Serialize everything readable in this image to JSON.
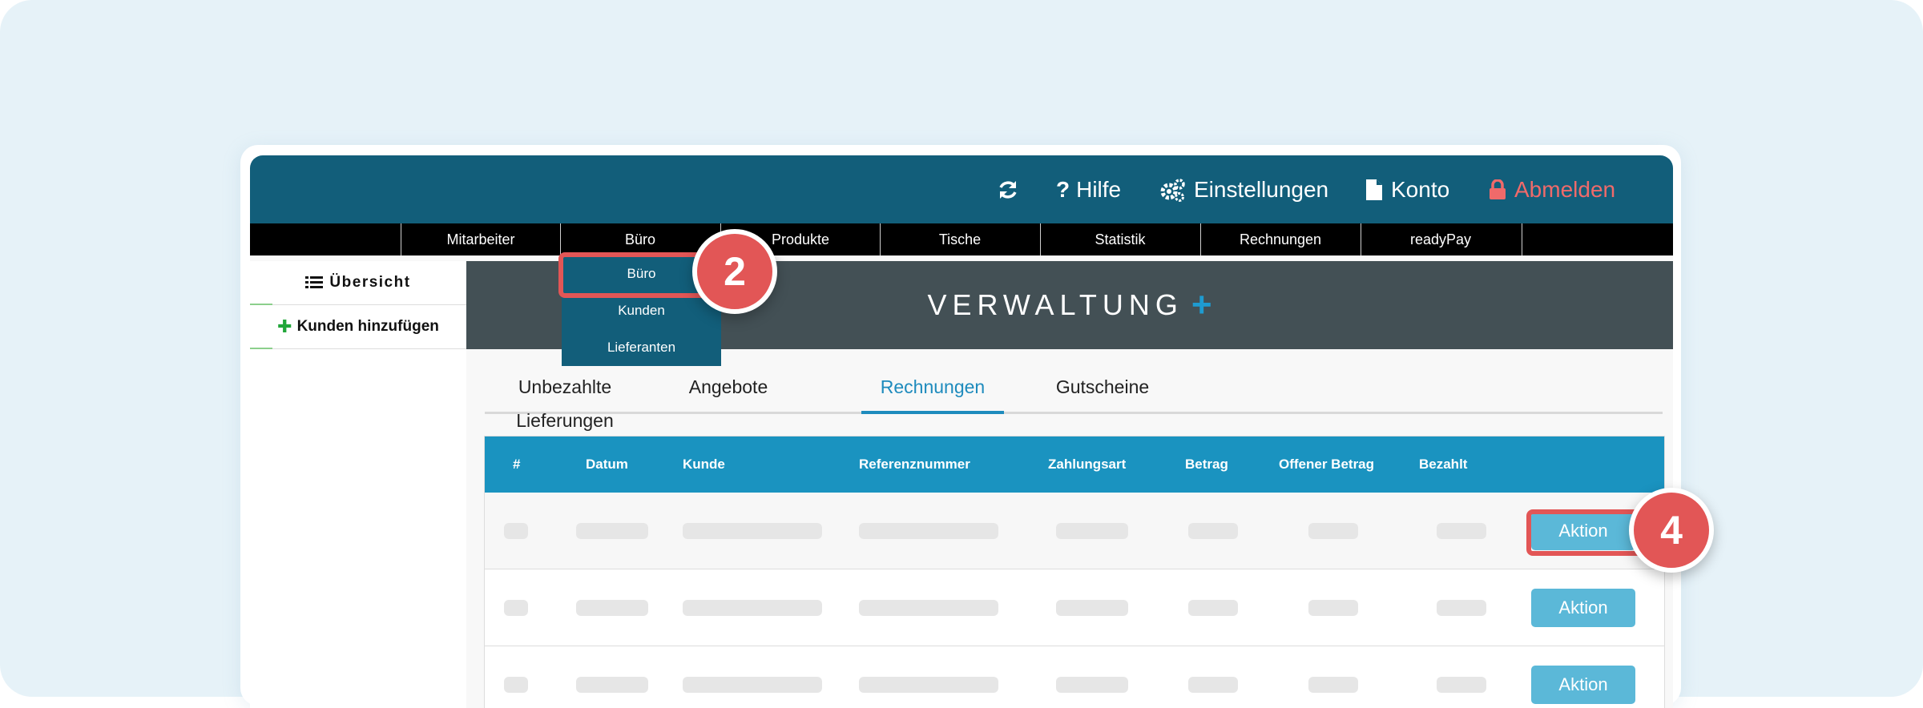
{
  "topbar": {
    "help": "Hilfe",
    "settings": "Einstellungen",
    "account": "Konto",
    "logout": "Abmelden"
  },
  "nav": {
    "items": [
      "Mitarbeiter",
      "Büro",
      "Produkte",
      "Tische",
      "Statistik",
      "Rechnungen",
      "readyPay"
    ]
  },
  "dropdown": {
    "items": [
      "Büro",
      "Kunden",
      "Lieferanten"
    ]
  },
  "sidebar": {
    "overview": "Übersicht",
    "add_customer": "Kunden hinzufügen"
  },
  "banner": {
    "title": "VERWALTUNG",
    "plus": "+"
  },
  "tabs": {
    "items": [
      "Unbezahlte Lieferungen",
      "Angebote",
      "Rechnungen",
      "Gutscheine"
    ],
    "active": "Rechnungen"
  },
  "table": {
    "headers": [
      "#",
      "Datum",
      "Kunde",
      "Referenznummer",
      "Zahlungsart",
      "Betrag",
      "Offener Betrag",
      "Bezahlt"
    ],
    "action_label": "Aktion"
  },
  "annotations": {
    "step_dropdown": "2",
    "step_action": "4"
  },
  "colors": {
    "topbar": "#125e7a",
    "banner": "#435055",
    "table_header": "#1a93c0",
    "accent": "#1e8bbd",
    "action_button": "#5bb8d8",
    "highlight": "#e25656",
    "logout": "#f06a6a"
  }
}
